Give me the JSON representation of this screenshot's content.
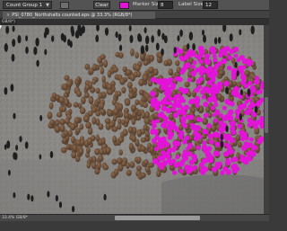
{
  "toolbar": {
    "count_group": "Count Group 1",
    "clear_label": "Clear",
    "marker_size_label": "Marker Size:",
    "marker_size_value": "8",
    "label_size_label": "Label Size:",
    "label_size_value": "12",
    "marker_color": "#e413d8"
  },
  "document": {
    "tab_title": "PSI_0780_Northshalts counted.eps @ 33.3% (RGB/8*)",
    "ruler_label": "GB/8*)"
  },
  "status": {
    "zoom": "33.4% GB/8*"
  },
  "counts": {
    "markers_on_image": "dense cluster"
  }
}
